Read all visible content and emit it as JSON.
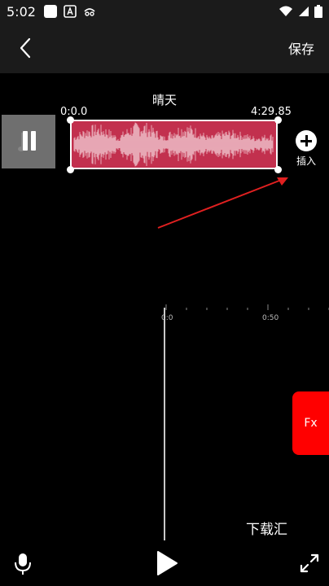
{
  "status_bar": {
    "time": "5:02"
  },
  "header": {
    "save_label": "保存"
  },
  "track": {
    "title": "晴天",
    "start_time": "0:0.0",
    "end_time": "4:29.85"
  },
  "insert": {
    "label": "插入"
  },
  "timeline": {
    "ticks": [
      "0:0",
      "0:50"
    ]
  },
  "fx": {
    "label": "Fx"
  },
  "watermark": "下载汇",
  "colors": {
    "waveform": "#c2304e",
    "fx": "#ff0000",
    "arrow": "#e02020"
  }
}
